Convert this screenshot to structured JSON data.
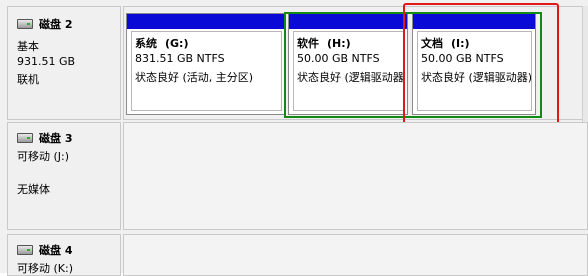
{
  "disks": [
    {
      "name": "磁盘 2",
      "type": "基本",
      "size": "931.51 GB",
      "status": "联机",
      "icon": "hard-drive-icon",
      "partitions": [
        {
          "name": "系统",
          "letter": "(G:)",
          "size_fs": "831.51 GB NTFS",
          "status": "状态良好 (活动, 主分区)"
        },
        {
          "name": "软件",
          "letter": "(H:)",
          "size_fs": "50.00 GB NTFS",
          "status": "状态良好 (逻辑驱动器)"
        },
        {
          "name": "文档",
          "letter": "(I:)",
          "size_fs": "50.00 GB NTFS",
          "status": "状态良好 (逻辑驱动器)"
        }
      ]
    },
    {
      "name": "磁盘 3",
      "type": "可移动 (J:)",
      "status": "无媒体",
      "icon": "removable-drive-icon"
    },
    {
      "name": "磁盘 4",
      "type": "可移动 (K:)",
      "icon": "removable-drive-icon"
    }
  ],
  "colors": {
    "partition_header": "#0a0ad6",
    "highlight_green": "#138a13",
    "highlight_red": "#e01818"
  }
}
